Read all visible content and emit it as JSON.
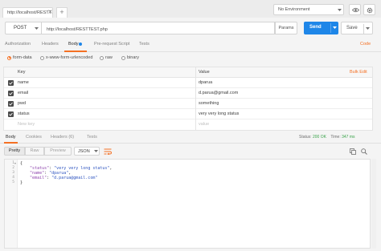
{
  "tab": {
    "title": "http://localhost/RESTT",
    "new_tab": "+"
  },
  "environment": {
    "label": "No Environment"
  },
  "request": {
    "method": "POST",
    "url": "http://localhost/RESTTEST.php",
    "params_label": "Params",
    "send_label": "Send",
    "save_label": "Save"
  },
  "request_tabs": {
    "authorization": "Authorization",
    "headers": "Headers",
    "body": "Body",
    "pre_request": "Pre-request Script",
    "tests": "Tests",
    "code": "Code"
  },
  "body_types": {
    "form_data": "form-data",
    "urlencoded": "x-www-form-urlencoded",
    "raw": "raw",
    "binary": "binary",
    "selected": "form-data"
  },
  "params_table": {
    "key_header": "Key",
    "value_header": "Value",
    "bulk_edit": "Bulk Edit",
    "rows": [
      {
        "key": "name",
        "value": "dparua",
        "checked": true
      },
      {
        "key": "email",
        "value": "d.parua@gmail.com",
        "checked": true
      },
      {
        "key": "pwd",
        "value": "something",
        "checked": true
      },
      {
        "key": "status",
        "value": "very very long status",
        "checked": true
      }
    ],
    "new_key_placeholder": "New key",
    "value_placeholder": "value"
  },
  "response_tabs": {
    "body": "Body",
    "cookies": "Cookies",
    "headers": "Headers (6)",
    "tests": "Tests"
  },
  "response_status": {
    "status_label": "Status:",
    "status_value": "200 OK",
    "time_label": "Time:",
    "time_value": "347 ms"
  },
  "response_toolbar": {
    "pretty": "Pretty",
    "raw": "Raw",
    "preview": "Preview",
    "format": "JSON"
  },
  "response_body": {
    "line_numbers": [
      "1",
      "2",
      "3",
      "4",
      "5"
    ],
    "open_brace": "{",
    "close_brace": "}",
    "indent": "    ",
    "lines": [
      {
        "key": "\"status\"",
        "value": "\"very very long status\"",
        "sep": ": ",
        "end": ","
      },
      {
        "key": "\"name\"",
        "value": "\"dparua\"",
        "sep": ": ",
        "end": ","
      },
      {
        "key": "\"email\"",
        "value": "\"d.parua@gmail.com\"",
        "sep": ": ",
        "end": ""
      }
    ]
  },
  "colors": {
    "accent": "#f47023",
    "send_button": "#1e86e8",
    "status_ok": "#3aa34a"
  }
}
